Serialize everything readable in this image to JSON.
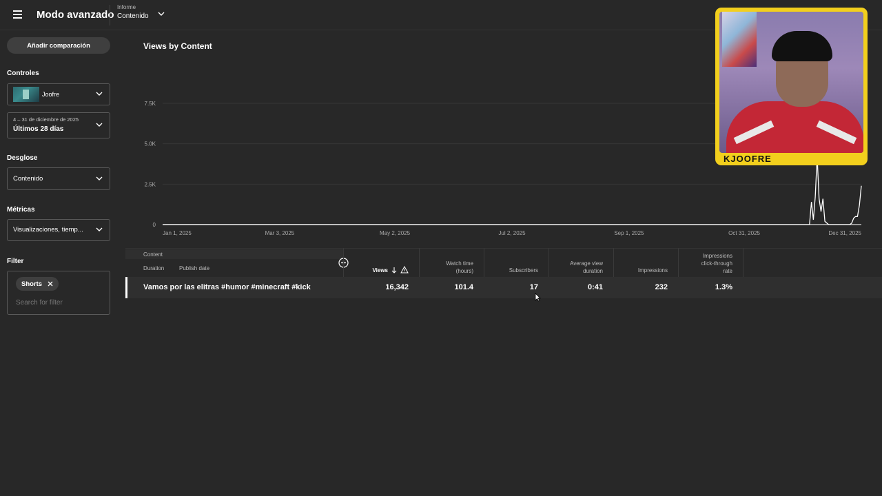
{
  "header": {
    "title": "Modo avanzado",
    "report_label": "Informe",
    "report_value": "Contenido"
  },
  "sidebar": {
    "add_comparison": "Añadir comparación",
    "controls_label": "Controles",
    "channel_name": "Joofre",
    "date_range_detail": "4 – 31 de diciembre de 2025",
    "date_range": "Últimos 28 días",
    "breakdown_label": "Desglose",
    "breakdown_value": "Contenido",
    "metrics_label": "Métricas",
    "metrics_value": "Visualizaciones, tiemp...",
    "filter_label": "Filter",
    "filter_chip": "Shorts",
    "filter_placeholder": "Search for filter"
  },
  "chart_data": {
    "type": "line",
    "title": "Views by Content",
    "x_ticks": [
      "Jan 1, 2025",
      "Mar 3, 2025",
      "May 2, 2025",
      "Jul 2, 2025",
      "Sep 1, 2025",
      "Oct 31, 2025",
      "Dec 31, 2025"
    ],
    "y_ticks": [
      "0",
      "2.5K",
      "5.0K",
      "7.5K"
    ],
    "ylim": [
      0,
      7500
    ],
    "xlim": [
      "2025-01-01",
      "2025-12-31"
    ],
    "grid": true,
    "x": [
      "2025-01-01",
      "2025-12-03",
      "2025-12-04",
      "2025-12-05",
      "2025-12-06",
      "2025-12-07",
      "2025-12-08",
      "2025-12-09",
      "2025-12-10",
      "2025-12-11",
      "2025-12-12",
      "2025-12-13",
      "2025-12-14",
      "2025-12-15",
      "2025-12-16",
      "2025-12-17",
      "2025-12-18",
      "2025-12-19",
      "2025-12-20",
      "2025-12-21",
      "2025-12-22",
      "2025-12-23",
      "2025-12-24",
      "2025-12-25",
      "2025-12-26",
      "2025-12-27",
      "2025-12-28",
      "2025-12-29",
      "2025-12-30",
      "2025-12-31"
    ],
    "values": [
      0,
      0,
      0,
      1400,
      300,
      1700,
      4200,
      1600,
      800,
      1600,
      200,
      100,
      0,
      0,
      0,
      0,
      0,
      0,
      0,
      0,
      0,
      0,
      0,
      0,
      100,
      400,
      500,
      500,
      1200,
      2400
    ]
  },
  "webcam": {
    "name": "KJOOFRE"
  },
  "table": {
    "headers": {
      "content": "Content",
      "duration": "Duration",
      "publish_date": "Publish date",
      "views": "Views",
      "watch_time_1": "Watch time",
      "watch_time_2": "(hours)",
      "subscribers": "Subscribers",
      "avg_view_1": "Average view",
      "avg_view_2": "duration",
      "impressions": "Impressions",
      "ctr_1": "Impressions",
      "ctr_2": "click-through",
      "ctr_3": "rate"
    },
    "row": {
      "title": "Vamos por las elitras #humor #minecraft #kick",
      "views": "16,342",
      "watch_time": "101.4",
      "subscribers": "17",
      "avg_view_duration": "0:41",
      "impressions": "232",
      "ctr": "1.3%"
    }
  }
}
